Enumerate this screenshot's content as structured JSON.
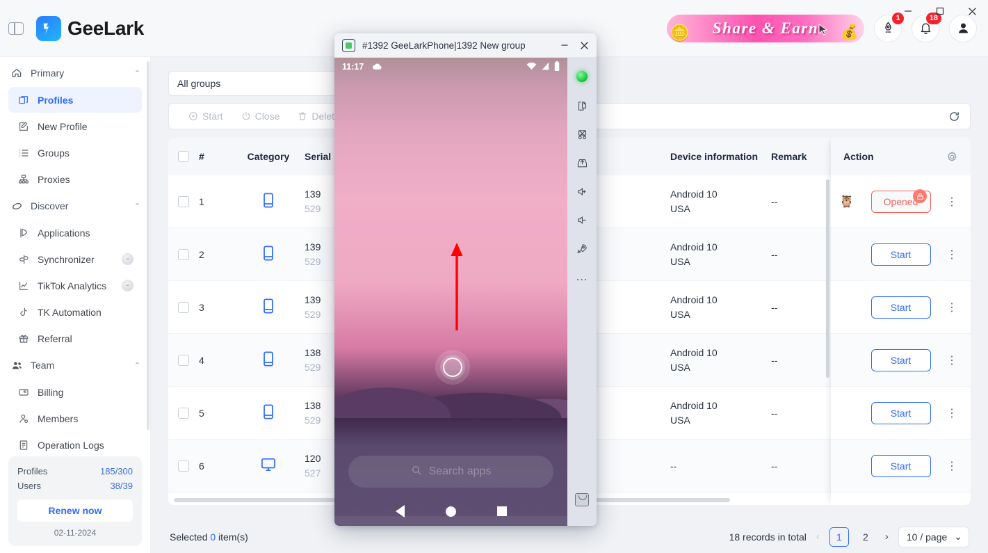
{
  "window": {
    "minimize": "—",
    "maximize": "□",
    "close": "✕"
  },
  "header": {
    "brand": "GeeLark",
    "panel_toggle_icon": "sidebar-toggle-icon",
    "share_banner": {
      "text": "Share  &  Earn",
      "chevron": "›"
    },
    "rocket_badge": "1",
    "bell_badge": "18"
  },
  "sidebar": {
    "groups": [
      {
        "label": "Primary",
        "icon": "home-icon",
        "chevron": "⌃",
        "items": [
          {
            "label": "Profiles",
            "icon": "profiles-icon",
            "active": true
          },
          {
            "label": "New Profile",
            "icon": "new-profile-icon"
          },
          {
            "label": "Groups",
            "icon": "groups-icon"
          },
          {
            "label": "Proxies",
            "icon": "proxies-icon"
          }
        ]
      },
      {
        "label": "Discover",
        "icon": "discover-icon",
        "chevron": "⌃",
        "items": [
          {
            "label": "Applications",
            "icon": "applications-icon"
          },
          {
            "label": "Synchronizer",
            "icon": "synchronizer-icon",
            "tag": "−"
          },
          {
            "label": "TikTok Analytics",
            "icon": "analytics-icon",
            "tag": "−"
          },
          {
            "label": "TK Automation",
            "icon": "tiktok-icon"
          },
          {
            "label": "Referral",
            "icon": "gift-icon"
          }
        ]
      },
      {
        "label": "Team",
        "icon": "team-icon",
        "chevron": "⌃",
        "items": [
          {
            "label": "Billing",
            "icon": "billing-icon"
          },
          {
            "label": "Members",
            "icon": "members-icon"
          },
          {
            "label": "Operation Logs",
            "icon": "logs-icon"
          }
        ]
      }
    ],
    "plan": {
      "profiles_label": "Profiles",
      "profiles_value": "185/300",
      "users_label": "Users",
      "users_value": "38/39",
      "renew_label": "Renew now",
      "date": "02-11-2024"
    }
  },
  "toolbar": {
    "group_filter": "All groups",
    "actions": [
      {
        "label": "Start",
        "icon": "play-circle-icon"
      },
      {
        "label": "Close",
        "icon": "power-icon"
      },
      {
        "label": "Delete",
        "icon": "trash-icon"
      }
    ],
    "search_value": "",
    "search_placeholder": "",
    "refresh_icon": "refresh-icon"
  },
  "table": {
    "columns": {
      "num": "#",
      "category": "Category",
      "serial": "Serial number",
      "device": "Device information",
      "remark": "Remark",
      "action": "Action"
    },
    "rows": [
      {
        "num": "1",
        "category_icon": "phone-icon",
        "serial_top": "139",
        "serial_bottom": "529",
        "device_os": "Android 10",
        "device_region": "USA",
        "remark": "--",
        "action": "Opened",
        "locked": true,
        "owl": true
      },
      {
        "num": "2",
        "category_icon": "phone-icon",
        "serial_top": "139",
        "serial_bottom": "529",
        "device_os": "Android 10",
        "device_region": "USA",
        "remark": "--",
        "action": "Start"
      },
      {
        "num": "3",
        "category_icon": "phone-icon",
        "serial_top": "139",
        "serial_bottom": "529",
        "device_os": "Android 10",
        "device_region": "USA",
        "remark": "--",
        "action": "Start"
      },
      {
        "num": "4",
        "category_icon": "phone-icon",
        "serial_top": "138",
        "serial_bottom": "529",
        "device_os": "Android 10",
        "device_region": "USA",
        "remark": "--",
        "action": "Start"
      },
      {
        "num": "5",
        "category_icon": "phone-icon",
        "serial_top": "138",
        "serial_bottom": "529",
        "device_os": "Android 10",
        "device_region": "USA",
        "remark": "--",
        "action": "Start"
      },
      {
        "num": "6",
        "category_icon": "desktop-icon",
        "serial_top": "120",
        "serial_bottom": "527",
        "device_os": "--",
        "device_region": "",
        "remark": "--",
        "action": "Start"
      }
    ]
  },
  "footer": {
    "selected_prefix": "Selected ",
    "selected_count": "0",
    "selected_suffix": " item(s)",
    "total": "18 records in total",
    "prev": "‹",
    "next": "›",
    "pages": [
      "1",
      "2"
    ],
    "current_page": "1",
    "page_size": "10 / page",
    "page_size_caret": "⌄"
  },
  "phone_window": {
    "title": "#1392 GeeLarkPhone|1392 New group",
    "minimize": "—",
    "close": "✕",
    "status_time": "11:17",
    "status_cloud_icon": "cloud-icon",
    "status_wifi_icon": "wifi-icon",
    "status_signal_icon": "signal-icon",
    "status_battery_icon": "battery-icon",
    "search_apps_placeholder": "Search apps",
    "search_icon": "search-icon",
    "nav_back_icon": "back-triangle-icon",
    "nav_home_icon": "home-circle-icon",
    "nav_recent_icon": "recents-square-icon",
    "annotation": {
      "arrow": "swipe-up-arrow",
      "touch": "touch-indicator"
    },
    "tools": [
      {
        "name": "status-dot",
        "label": ""
      },
      {
        "name": "clipboard-icon",
        "label": ""
      },
      {
        "name": "scissors-icon",
        "label": ""
      },
      {
        "name": "upload-icon",
        "label": ""
      },
      {
        "name": "volume-up-icon",
        "label": ""
      },
      {
        "name": "volume-down-icon",
        "label": ""
      },
      {
        "name": "rocket-icon",
        "label": ""
      },
      {
        "name": "more-icon",
        "label": "…"
      }
    ],
    "tray_icon": "tray-collapse-icon"
  }
}
